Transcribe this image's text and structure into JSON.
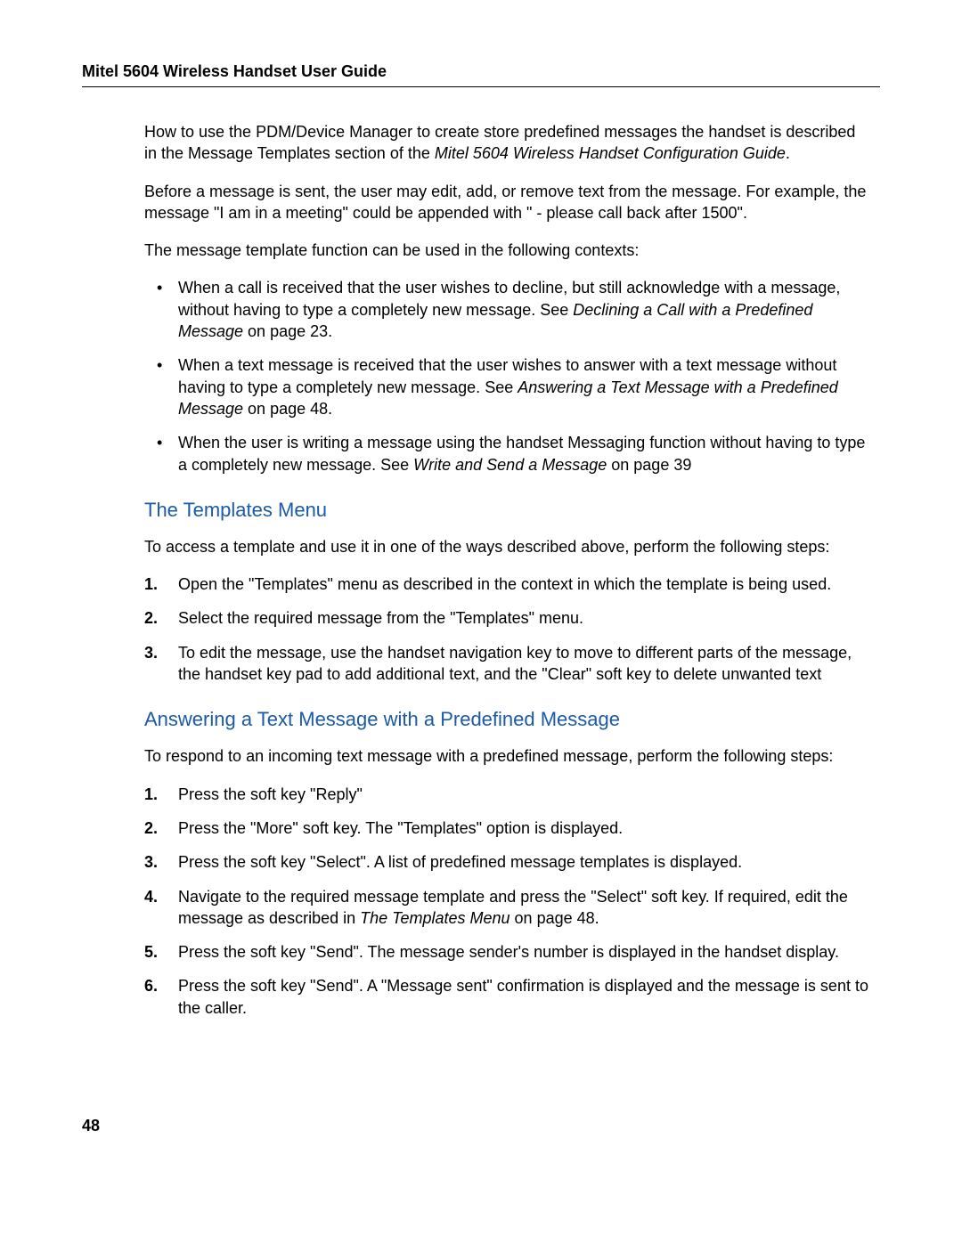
{
  "header": {
    "title": "Mitel 5604 Wireless Handset User Guide"
  },
  "intro": {
    "p1_a": "How to use the PDM/Device Manager to create store predefined messages the handset is described in the Message Templates section of the ",
    "p1_i": "Mitel 5604 Wireless Handset Configuration Guide",
    "p1_b": ".",
    "p2": "Before a message is sent, the user may edit, add, or remove text from the message. For example, the message \"I am in a meeting\" could be appended with \" - please call back after 1500\".",
    "p3": "The message template function can be used in the following contexts:"
  },
  "bullets": [
    {
      "a": "When a call is received that the user wishes to decline, but still acknowledge with a message, without having to type a completely new message. See ",
      "i": "Declining a Call with a Predefined Message",
      "b": " on page 23."
    },
    {
      "a": "When a text message is received that the user wishes to answer with a text message without having to type a completely new message. See ",
      "i": "Answering a Text Message with a Predefined Message",
      "b": " on page 48."
    },
    {
      "a": "When the user is writing a message using the handset Messaging function without having to type a completely new message. See ",
      "i": "Write and Send a Message",
      "b": " on page 39"
    }
  ],
  "section1": {
    "heading": "The Templates Menu",
    "intro": "To access a template and use it in one of the ways described above, perform the following steps:",
    "steps": [
      "Open the \"Templates\" menu as described in the context in which the template is being used.",
      "Select the required message from the \"Templates\" menu.",
      "To edit the message, use the handset navigation key to move to different parts of the message, the handset key pad to add additional text, and the \"Clear\" soft key to delete unwanted text"
    ]
  },
  "section2": {
    "heading": "Answering a Text Message with a Predefined Message",
    "intro": "To respond to an incoming text message with a predefined message, perform the following steps:",
    "steps_plain": {
      "s1": "Press the soft key \"Reply\"",
      "s2": "Press the \"More\" soft key. The \"Templates\" option is displayed.",
      "s3": "Press the soft key \"Select\". A list of predefined message templates is displayed.",
      "s5": "Press the soft key \"Send\". The message sender's number is displayed in the handset display.",
      "s6": "Press the soft key \"Send\". A \"Message sent\" confirmation is displayed and the message is sent to the caller."
    },
    "step4": {
      "a": "Navigate to the required message template and press the \"Select\" soft key. If required, edit the message as described in ",
      "i": "The Templates Menu",
      "b": " on page 48."
    }
  },
  "pageNumber": "48"
}
